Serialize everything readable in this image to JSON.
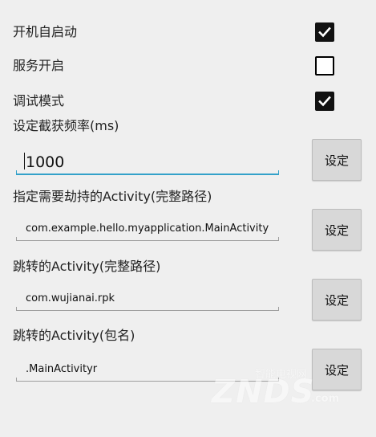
{
  "settings": {
    "autostart": {
      "label": "开机自启动",
      "checked": true
    },
    "service": {
      "label": "服务开启",
      "checked": false
    },
    "debug": {
      "label": "调试模式",
      "checked": true
    }
  },
  "capture": {
    "label": "设定截获频率(ms)",
    "value": "1000",
    "button": "设定"
  },
  "hijack": {
    "label": "指定需要劫持的Activity(完整路径)",
    "value": "com.example.hello.myapplication.MainActivity",
    "button": "设定"
  },
  "jump_full": {
    "label": "跳转的Activity(完整路径)",
    "value": "com.wujianai.rpk",
    "button": "设定"
  },
  "jump_pkg": {
    "label": "跳转的Activity(包名)",
    "value": ".MainActivityr",
    "button": "设定"
  },
  "watermark": {
    "brand": "ZNDS",
    "subtitle": "智能电视网",
    "domain": ".com"
  }
}
